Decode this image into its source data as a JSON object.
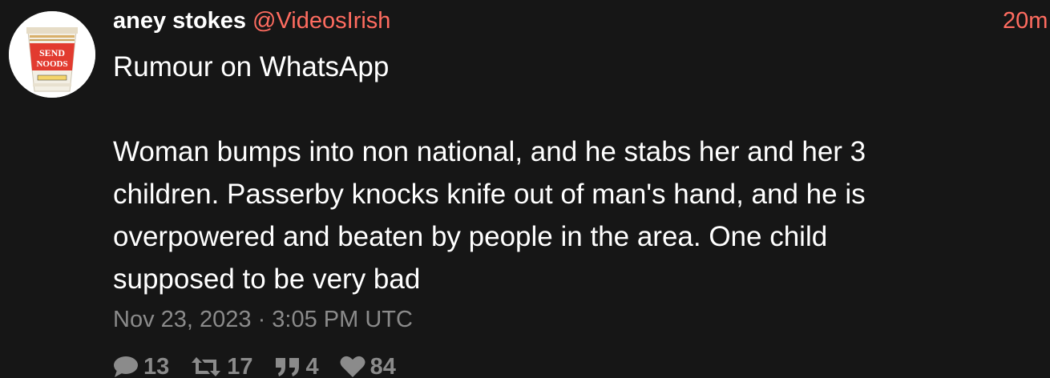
{
  "tweet": {
    "fullname": "aney stokes",
    "username": "@VideosIrish",
    "time_ago": "20m",
    "content_lines": [
      "Rumour on WhatsApp",
      "",
      "Woman bumps into non national, and he stabs her and her 3",
      "children. Passerby knocks knife out of man's hand, and he is",
      "overpowered and beaten by people in the area. One child",
      "supposed to be very bad"
    ],
    "date": "Nov 23, 2023 · 3:05 PM UTC",
    "avatar_text": "SEND NOODS",
    "stats": {
      "replies": "13",
      "retweets": "17",
      "quotes": "4",
      "likes": "84"
    }
  },
  "colors": {
    "background": "#161616",
    "accent": "#ff6c60",
    "muted": "#8b8b8b",
    "text": "#ffffff"
  },
  "icons": [
    "comment-icon",
    "retweet-icon",
    "quote-icon",
    "heart-icon"
  ]
}
